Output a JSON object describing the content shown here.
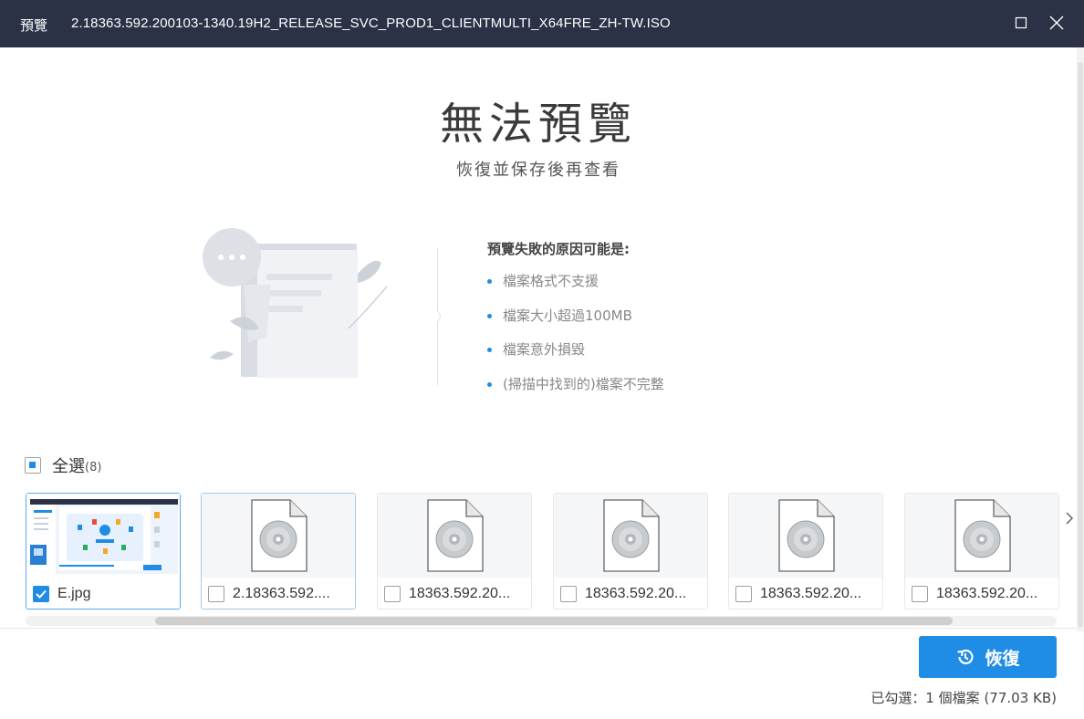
{
  "titlebar": {
    "label": "預覽",
    "filename": "2.18363.592.200103-1340.19H2_RELEASE_SVC_PROD1_CLIENTMULTI_X64FRE_ZH-TW.ISO"
  },
  "main": {
    "title": "無法預覽",
    "subtitle": "恢復並保存後再查看"
  },
  "reasons": {
    "title": "預覽失敗的原因可能是:",
    "items": [
      "檔案格式不支援",
      "檔案大小超過100MB",
      "檔案意外損毀",
      "(掃描中找到的)檔案不完整"
    ]
  },
  "select_all": {
    "label": "全選",
    "count": "(8)"
  },
  "thumbnails": [
    {
      "name": "E.jpg",
      "checked": true,
      "type": "image"
    },
    {
      "name": "2.18363.592....",
      "checked": false,
      "type": "disc"
    },
    {
      "name": "18363.592.20...",
      "checked": false,
      "type": "disc"
    },
    {
      "name": "18363.592.20...",
      "checked": false,
      "type": "disc"
    },
    {
      "name": "18363.592.20...",
      "checked": false,
      "type": "disc"
    },
    {
      "name": "18363.592.20...",
      "checked": false,
      "type": "disc"
    }
  ],
  "footer": {
    "recover_label": "恢復",
    "status": "已勾選：1 個檔案 (77.03 KB)"
  },
  "colors": {
    "accent": "#1f8ce6",
    "titlebar_bg": "#2b3246"
  },
  "icons": {
    "maximize": "maximize-icon",
    "close": "close-icon",
    "recover": "history-icon",
    "next": "chevron-right-icon",
    "file": "disc-file-icon"
  }
}
